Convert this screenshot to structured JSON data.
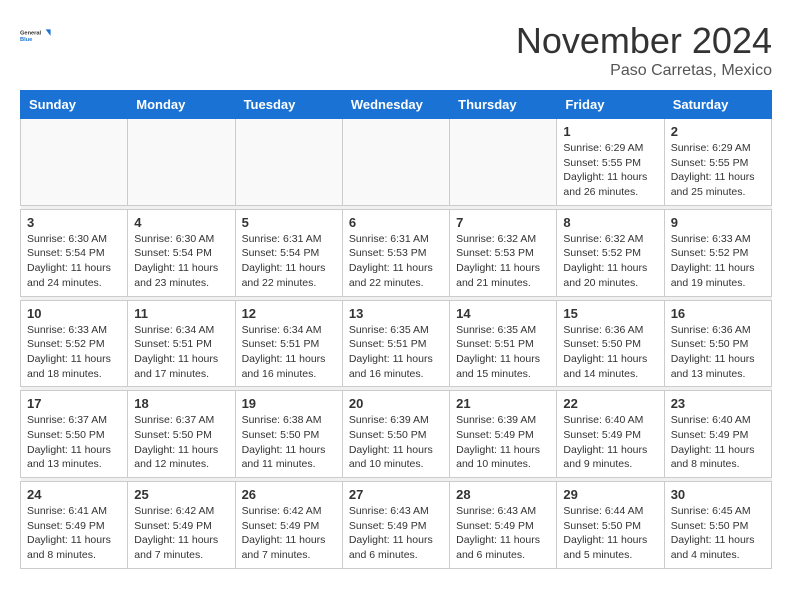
{
  "logo": {
    "line1": "General",
    "line2": "Blue"
  },
  "title": "November 2024",
  "location": "Paso Carretas, Mexico",
  "days_of_week": [
    "Sunday",
    "Monday",
    "Tuesday",
    "Wednesday",
    "Thursday",
    "Friday",
    "Saturday"
  ],
  "weeks": [
    [
      {
        "day": "",
        "info": ""
      },
      {
        "day": "",
        "info": ""
      },
      {
        "day": "",
        "info": ""
      },
      {
        "day": "",
        "info": ""
      },
      {
        "day": "",
        "info": ""
      },
      {
        "day": "1",
        "info": "Sunrise: 6:29 AM\nSunset: 5:55 PM\nDaylight: 11 hours and 26 minutes."
      },
      {
        "day": "2",
        "info": "Sunrise: 6:29 AM\nSunset: 5:55 PM\nDaylight: 11 hours and 25 minutes."
      }
    ],
    [
      {
        "day": "3",
        "info": "Sunrise: 6:30 AM\nSunset: 5:54 PM\nDaylight: 11 hours and 24 minutes."
      },
      {
        "day": "4",
        "info": "Sunrise: 6:30 AM\nSunset: 5:54 PM\nDaylight: 11 hours and 23 minutes."
      },
      {
        "day": "5",
        "info": "Sunrise: 6:31 AM\nSunset: 5:54 PM\nDaylight: 11 hours and 22 minutes."
      },
      {
        "day": "6",
        "info": "Sunrise: 6:31 AM\nSunset: 5:53 PM\nDaylight: 11 hours and 22 minutes."
      },
      {
        "day": "7",
        "info": "Sunrise: 6:32 AM\nSunset: 5:53 PM\nDaylight: 11 hours and 21 minutes."
      },
      {
        "day": "8",
        "info": "Sunrise: 6:32 AM\nSunset: 5:52 PM\nDaylight: 11 hours and 20 minutes."
      },
      {
        "day": "9",
        "info": "Sunrise: 6:33 AM\nSunset: 5:52 PM\nDaylight: 11 hours and 19 minutes."
      }
    ],
    [
      {
        "day": "10",
        "info": "Sunrise: 6:33 AM\nSunset: 5:52 PM\nDaylight: 11 hours and 18 minutes."
      },
      {
        "day": "11",
        "info": "Sunrise: 6:34 AM\nSunset: 5:51 PM\nDaylight: 11 hours and 17 minutes."
      },
      {
        "day": "12",
        "info": "Sunrise: 6:34 AM\nSunset: 5:51 PM\nDaylight: 11 hours and 16 minutes."
      },
      {
        "day": "13",
        "info": "Sunrise: 6:35 AM\nSunset: 5:51 PM\nDaylight: 11 hours and 16 minutes."
      },
      {
        "day": "14",
        "info": "Sunrise: 6:35 AM\nSunset: 5:51 PM\nDaylight: 11 hours and 15 minutes."
      },
      {
        "day": "15",
        "info": "Sunrise: 6:36 AM\nSunset: 5:50 PM\nDaylight: 11 hours and 14 minutes."
      },
      {
        "day": "16",
        "info": "Sunrise: 6:36 AM\nSunset: 5:50 PM\nDaylight: 11 hours and 13 minutes."
      }
    ],
    [
      {
        "day": "17",
        "info": "Sunrise: 6:37 AM\nSunset: 5:50 PM\nDaylight: 11 hours and 13 minutes."
      },
      {
        "day": "18",
        "info": "Sunrise: 6:37 AM\nSunset: 5:50 PM\nDaylight: 11 hours and 12 minutes."
      },
      {
        "day": "19",
        "info": "Sunrise: 6:38 AM\nSunset: 5:50 PM\nDaylight: 11 hours and 11 minutes."
      },
      {
        "day": "20",
        "info": "Sunrise: 6:39 AM\nSunset: 5:50 PM\nDaylight: 11 hours and 10 minutes."
      },
      {
        "day": "21",
        "info": "Sunrise: 6:39 AM\nSunset: 5:49 PM\nDaylight: 11 hours and 10 minutes."
      },
      {
        "day": "22",
        "info": "Sunrise: 6:40 AM\nSunset: 5:49 PM\nDaylight: 11 hours and 9 minutes."
      },
      {
        "day": "23",
        "info": "Sunrise: 6:40 AM\nSunset: 5:49 PM\nDaylight: 11 hours and 8 minutes."
      }
    ],
    [
      {
        "day": "24",
        "info": "Sunrise: 6:41 AM\nSunset: 5:49 PM\nDaylight: 11 hours and 8 minutes."
      },
      {
        "day": "25",
        "info": "Sunrise: 6:42 AM\nSunset: 5:49 PM\nDaylight: 11 hours and 7 minutes."
      },
      {
        "day": "26",
        "info": "Sunrise: 6:42 AM\nSunset: 5:49 PM\nDaylight: 11 hours and 7 minutes."
      },
      {
        "day": "27",
        "info": "Sunrise: 6:43 AM\nSunset: 5:49 PM\nDaylight: 11 hours and 6 minutes."
      },
      {
        "day": "28",
        "info": "Sunrise: 6:43 AM\nSunset: 5:49 PM\nDaylight: 11 hours and 6 minutes."
      },
      {
        "day": "29",
        "info": "Sunrise: 6:44 AM\nSunset: 5:50 PM\nDaylight: 11 hours and 5 minutes."
      },
      {
        "day": "30",
        "info": "Sunrise: 6:45 AM\nSunset: 5:50 PM\nDaylight: 11 hours and 4 minutes."
      }
    ]
  ]
}
